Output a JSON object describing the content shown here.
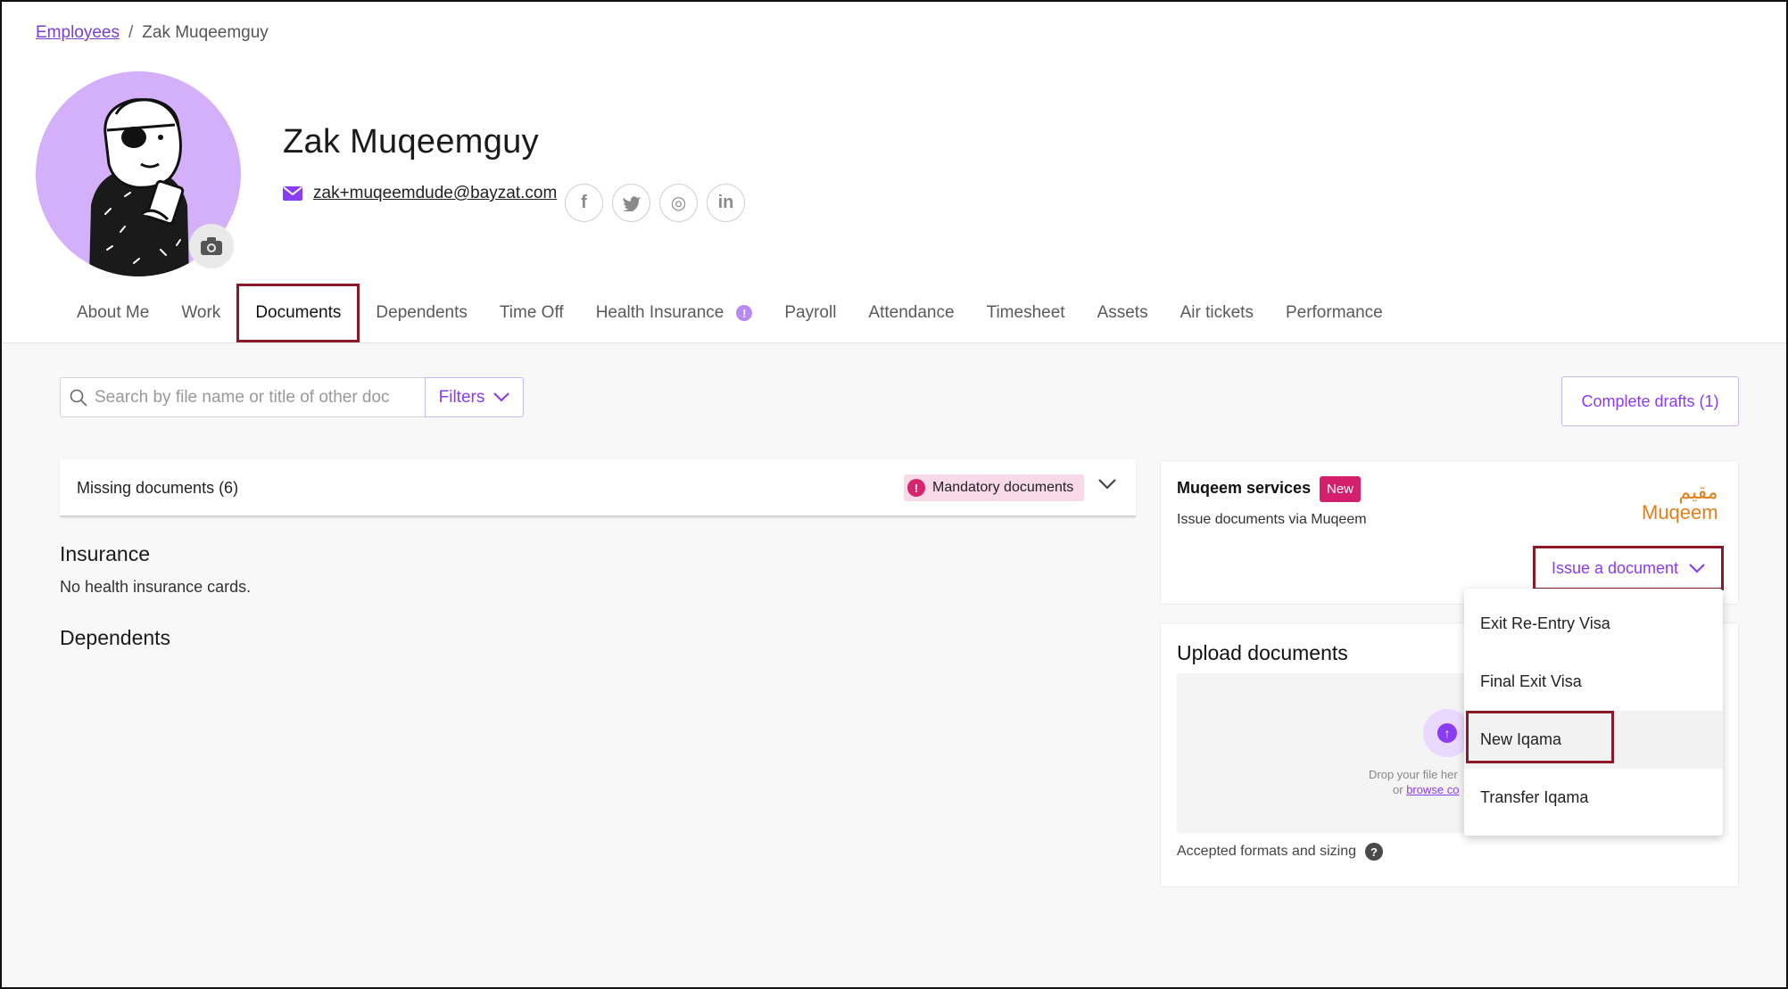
{
  "breadcrumb": {
    "root": "Employees",
    "separator": "/",
    "current": "Zak Muqeemguy"
  },
  "profile": {
    "name": "Zak Muqeemguy",
    "email": "zak+muqeemdude@bayzat.com",
    "socials": [
      "facebook-icon",
      "twitter-icon",
      "instagram-icon",
      "linkedin-icon"
    ],
    "social_glyphs": {
      "facebook": "f",
      "instagram": "◎",
      "linkedin": "in"
    }
  },
  "tabs": [
    {
      "label": "About Me"
    },
    {
      "label": "Work"
    },
    {
      "label": "Documents",
      "active": true
    },
    {
      "label": "Dependents"
    },
    {
      "label": "Time Off"
    },
    {
      "label": "Health Insurance",
      "alert": "!"
    },
    {
      "label": "Payroll"
    },
    {
      "label": "Attendance"
    },
    {
      "label": "Timesheet"
    },
    {
      "label": "Assets"
    },
    {
      "label": "Air tickets"
    },
    {
      "label": "Performance"
    }
  ],
  "toolbar": {
    "search_placeholder": "Search by file name or title of other doc",
    "filters_label": "Filters",
    "complete_drafts_label": "Complete drafts (1)"
  },
  "missing": {
    "title": "Missing documents (6)",
    "badge_icon": "!",
    "badge_label": "Mandatory documents"
  },
  "insurance": {
    "title": "Insurance",
    "text": "No health insurance cards."
  },
  "dependents": {
    "title": "Dependents"
  },
  "muqeem": {
    "title": "Muqeem services",
    "badge": "New",
    "subtitle": "Issue documents via Muqeem",
    "logo_ar": "مقيم",
    "logo_en": "Muqeem",
    "issue_label": "Issue a document"
  },
  "upload": {
    "title": "Upload documents",
    "drop_text": "Drop your file her",
    "or_text": "or",
    "browse_text": "browse co",
    "accepted_label": "Accepted formats and sizing",
    "help_icon": "?"
  },
  "dropdown": {
    "items": [
      "Exit Re-Entry Visa",
      "Final Exit Visa",
      "New Iqama",
      "Transfer Iqama"
    ],
    "highlighted_index": 2
  },
  "colors": {
    "accent": "#8a3cf0",
    "highlight_box": "#8b1a2b",
    "avatar_bg": "#d4b0fb",
    "badge_new": "#d41f6c",
    "muqeem_logo": "#e0801b"
  }
}
